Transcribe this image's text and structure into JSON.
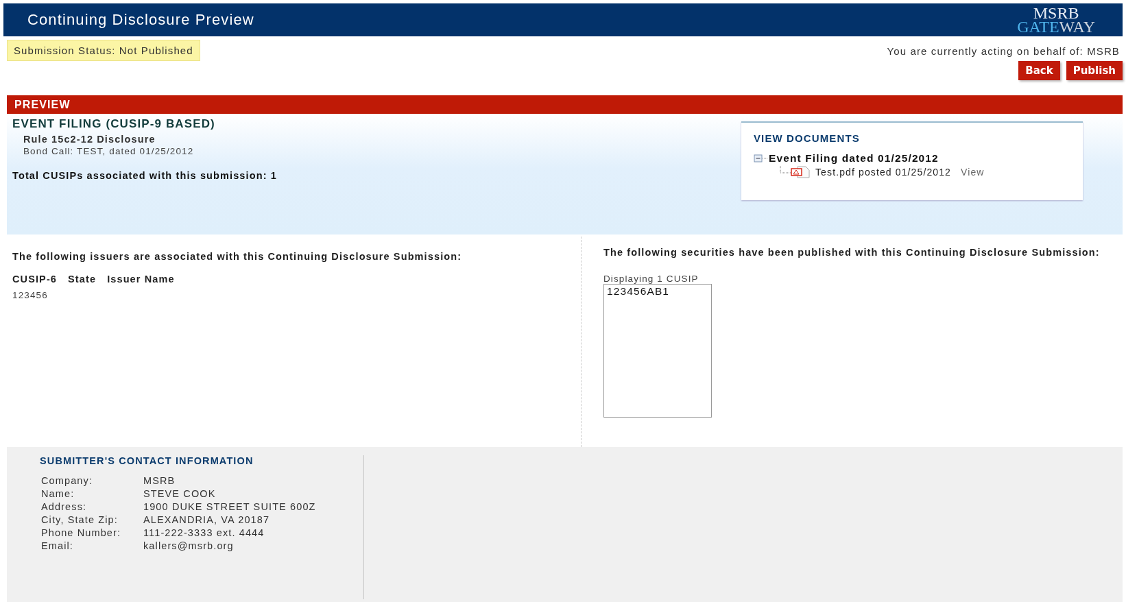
{
  "header": {
    "title": "Continuing Disclosure Preview",
    "logo_top": "MSRB",
    "logo_accent": "GATE",
    "logo_rest": "WAY"
  },
  "status": {
    "text": "Submission Status: Not Published",
    "acting": "You are currently acting on behalf of: MSRB"
  },
  "buttons": [
    "Back",
    "Publish"
  ],
  "preview": {
    "bar": "PREVIEW",
    "heading": "EVENT FILING (CUSIP-9 BASED)",
    "subheading": "Rule 15c2-12 Disclosure",
    "detail": "Bond Call: TEST, dated 01/25/2012",
    "total": "Total CUSIPs associated with this submission: 1"
  },
  "documents": {
    "title": "VIEW DOCUMENTS",
    "tree": [
      {
        "label": "Event Filing dated 01/25/2012",
        "expanded": true,
        "children": [
          {
            "label": "Test.pdf posted 01/25/2012",
            "link": "View"
          }
        ]
      }
    ]
  },
  "issuers": {
    "title": "The following issuers are associated with this Continuing Disclosure Submission:",
    "columns": [
      "CUSIP-6",
      "State",
      "Issuer Name"
    ],
    "rows": [
      [
        "123456"
      ]
    ]
  },
  "securities": {
    "title": "The following securities have been published with this Continuing Disclosure Submission:",
    "count": "Displaying 1 CUSIP",
    "items": [
      "123456AB1"
    ]
  },
  "contact": {
    "title": "SUBMITTER'S CONTACT INFORMATION",
    "fields": [
      {
        "label": "Company:",
        "value": "MSRB"
      },
      {
        "label": "Name:",
        "value": "STEVE COOK"
      },
      {
        "label": "Address:",
        "value": "1900 DUKE STREET SUITE 600Z"
      },
      {
        "label": "City, State Zip:",
        "value": "ALEXANDRIA, VA 20187"
      },
      {
        "label": "Phone Number:",
        "value": "111-222-3333 ext. 4444"
      },
      {
        "label": "Email:",
        "value": "kallers@msrb.org"
      }
    ]
  }
}
